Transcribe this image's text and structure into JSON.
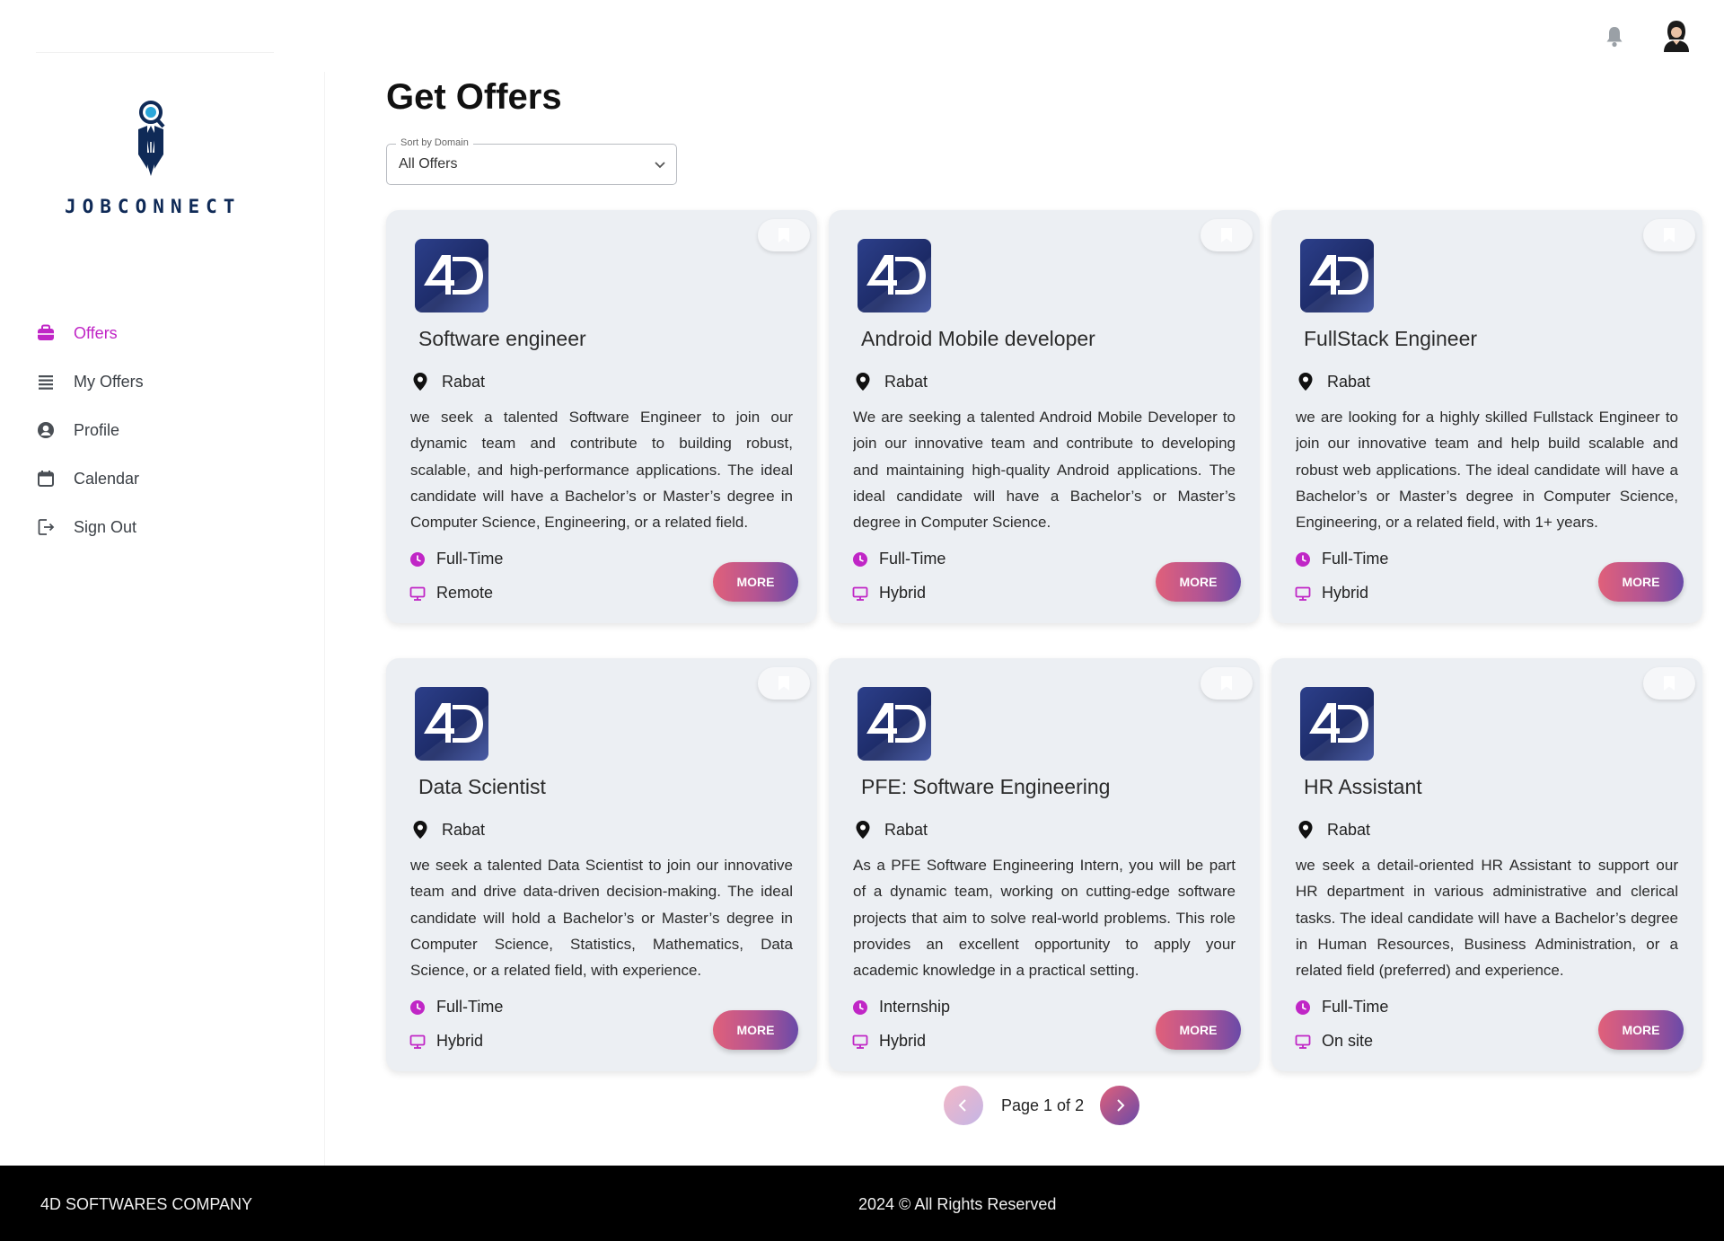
{
  "header": {
    "notification_icon": "bell-icon",
    "avatar_icon": "user-avatar-icon"
  },
  "brand": {
    "name": "JOBCONNECT",
    "accent": "#c026c6",
    "navy": "#0f2a57"
  },
  "sidebar": {
    "items": [
      {
        "label": "Offers",
        "icon": "briefcase-icon",
        "active": true
      },
      {
        "label": "My Offers",
        "icon": "list-icon",
        "active": false
      },
      {
        "label": "Profile",
        "icon": "user-circle-icon",
        "active": false
      },
      {
        "label": "Calendar",
        "icon": "calendar-icon",
        "active": false
      },
      {
        "label": "Sign Out",
        "icon": "sign-out-icon",
        "active": false
      }
    ]
  },
  "main": {
    "title": "Get Offers",
    "sort": {
      "label": "Sort by Domain",
      "value": "All Offers"
    }
  },
  "offers": [
    {
      "title": "Software engineer",
      "location": "Rabat",
      "description": "we seek a talented Software Engineer to join our dynamic team and contribute to building robust, scalable, and high-performance applications. The ideal candidate will have a Bachelor’s or Master’s degree in Computer Science, Engineering, or a related field.",
      "type": "Full-Time",
      "mode": "Remote",
      "more_label": "MORE"
    },
    {
      "title": "Android Mobile developer",
      "location": "Rabat",
      "description": "We are seeking a talented Android Mobile Developer to join our innovative team and contribute to developing and maintaining high-quality Android applications. The ideal candidate will have a Bachelor’s or Master’s degree in Computer Science.",
      "type": "Full-Time",
      "mode": "Hybrid",
      "more_label": "MORE"
    },
    {
      "title": "FullStack Engineer",
      "location": "Rabat",
      "description": "we are looking for a highly skilled Fullstack Engineer to join our innovative team and help build scalable and robust web applications. The ideal candidate will have a Bachelor’s or Master’s degree in Computer Science, Engineering, or a related field, with 1+ years.",
      "type": "Full-Time",
      "mode": "Hybrid",
      "more_label": "MORE"
    },
    {
      "title": "Data Scientist",
      "location": "Rabat",
      "description": "we seek a talented Data Scientist to join our innovative team and drive data-driven decision-making. The ideal candidate will hold a Bachelor’s or Master’s degree in Computer Science, Statistics, Mathematics, Data Science, or a related field, with experience.",
      "type": "Full-Time",
      "mode": "Hybrid",
      "more_label": "MORE"
    },
    {
      "title": "PFE: Software Engineering",
      "location": "Rabat",
      "description": "As a PFE Software Engineering Intern, you will be part of a dynamic team, working on cutting-edge software projects that aim to solve real-world problems. This role provides an excellent opportunity to apply your academic knowledge in a practical setting.",
      "type": "Internship",
      "mode": "Hybrid",
      "more_label": "MORE"
    },
    {
      "title": "HR Assistant",
      "location": "Rabat",
      "description": "we seek a detail-oriented HR Assistant to support our HR department in various administrative and clerical tasks. The ideal candidate will have a Bachelor’s degree in Human Resources, Business Administration, or a related field (preferred) and experience.",
      "type": "Full-Time",
      "mode": "On site",
      "more_label": "MORE"
    }
  ],
  "pagination": {
    "text": "Page 1 of 2"
  },
  "footer": {
    "company": "4D SOFTWARES COMPANY",
    "copyright": "2024 © All Rights Reserved"
  }
}
